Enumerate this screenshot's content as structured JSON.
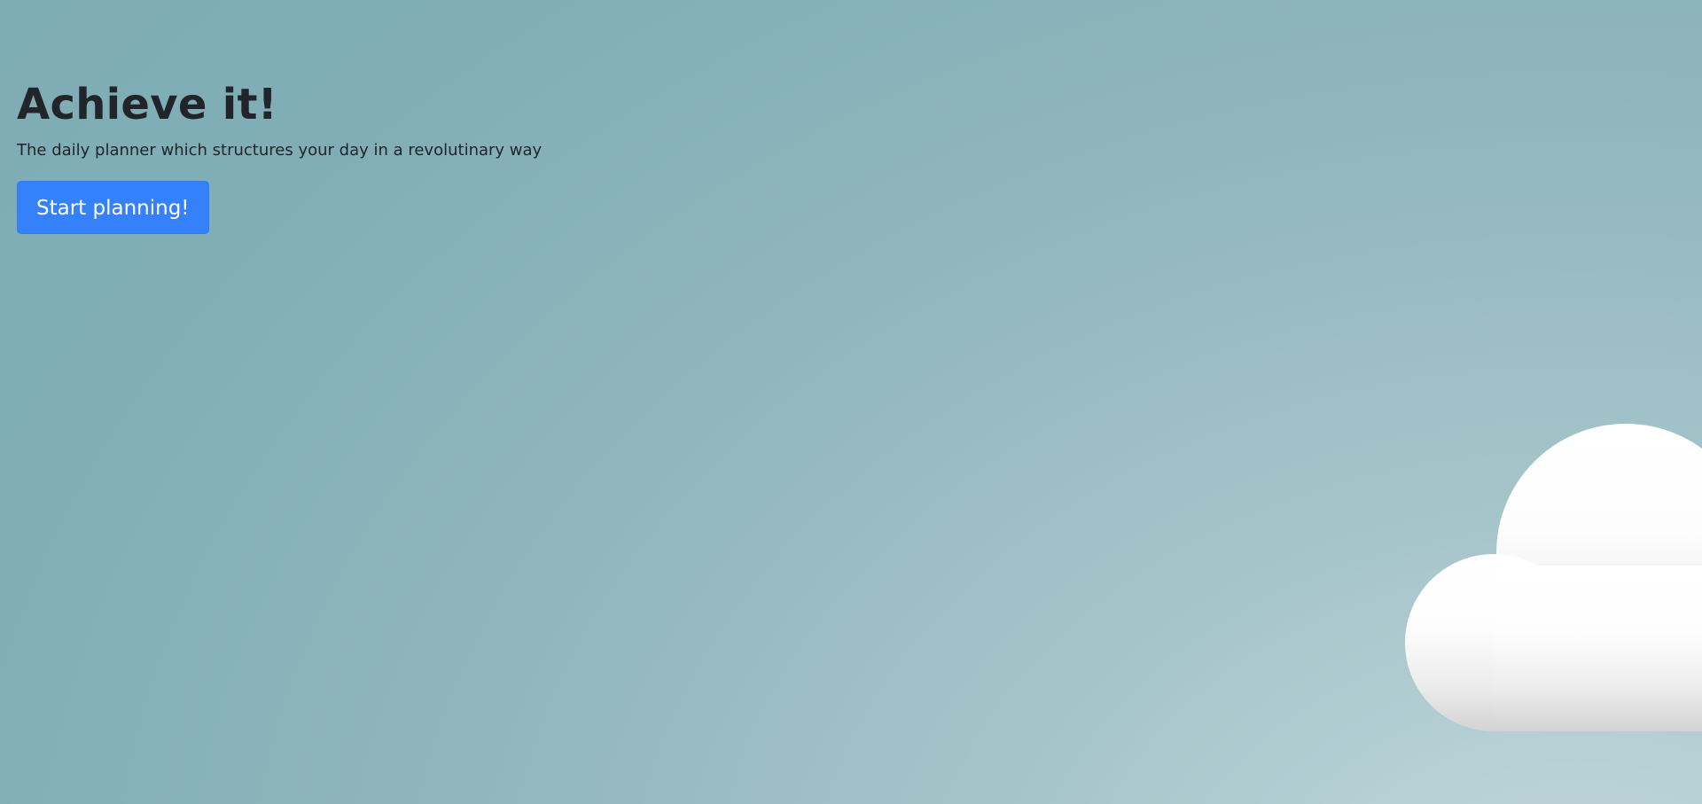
{
  "hero": {
    "title": "Achieve it!",
    "subtitle": "The daily planner which structures your day in a revolutinary way",
    "cta_label": "Start planning!"
  },
  "colors": {
    "button": "#3580fb",
    "text": "#212529",
    "background": "#8fb4bb",
    "cloud": "#ffffff"
  },
  "decoration": {
    "icon": "cloud-icon"
  }
}
